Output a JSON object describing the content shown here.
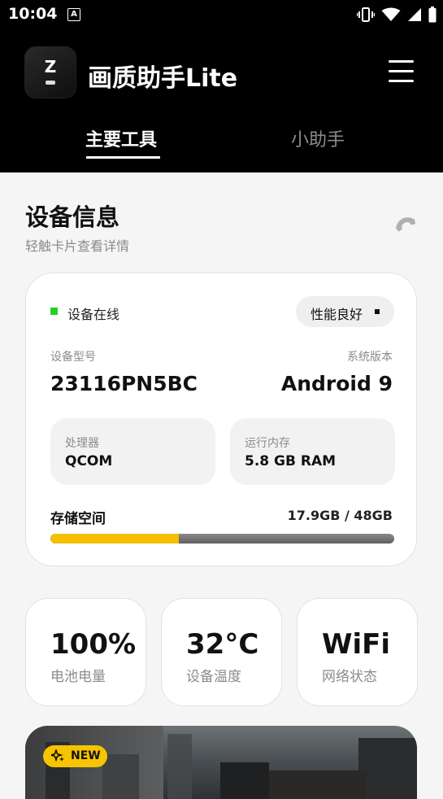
{
  "status_bar": {
    "time": "10:04",
    "notification_glyph": "A"
  },
  "app": {
    "title": "画质助手Lite",
    "icon_letter": "Z"
  },
  "tabs": [
    {
      "label": "主要工具",
      "active": true
    },
    {
      "label": "小助手",
      "active": false
    }
  ],
  "device_section": {
    "title": "设备信息",
    "subtitle": "轻触卡片查看详情"
  },
  "device_card": {
    "status": "设备在线",
    "performance_badge": "性能良好",
    "model_label": "设备型号",
    "model_value": "23116PN5BC",
    "system_label": "系统版本",
    "system_value": "Android 9",
    "cpu_label": "处理器",
    "cpu_value": "QCOM",
    "ram_label": "运行内存",
    "ram_value": "5.8 GB RAM",
    "storage_label": "存储空间",
    "storage_value": "17.9GB / 48GB",
    "storage_used_fraction": 0.373
  },
  "stats": [
    {
      "value": "100%",
      "label": "电池电量"
    },
    {
      "value": "32°C",
      "label": "设备温度"
    },
    {
      "value": "WiFi",
      "label": "网络状态"
    }
  ],
  "banner": {
    "badge": "NEW"
  },
  "colors": {
    "online": "#27d024",
    "accent": "#f5c000",
    "header_bg": "#000000"
  }
}
